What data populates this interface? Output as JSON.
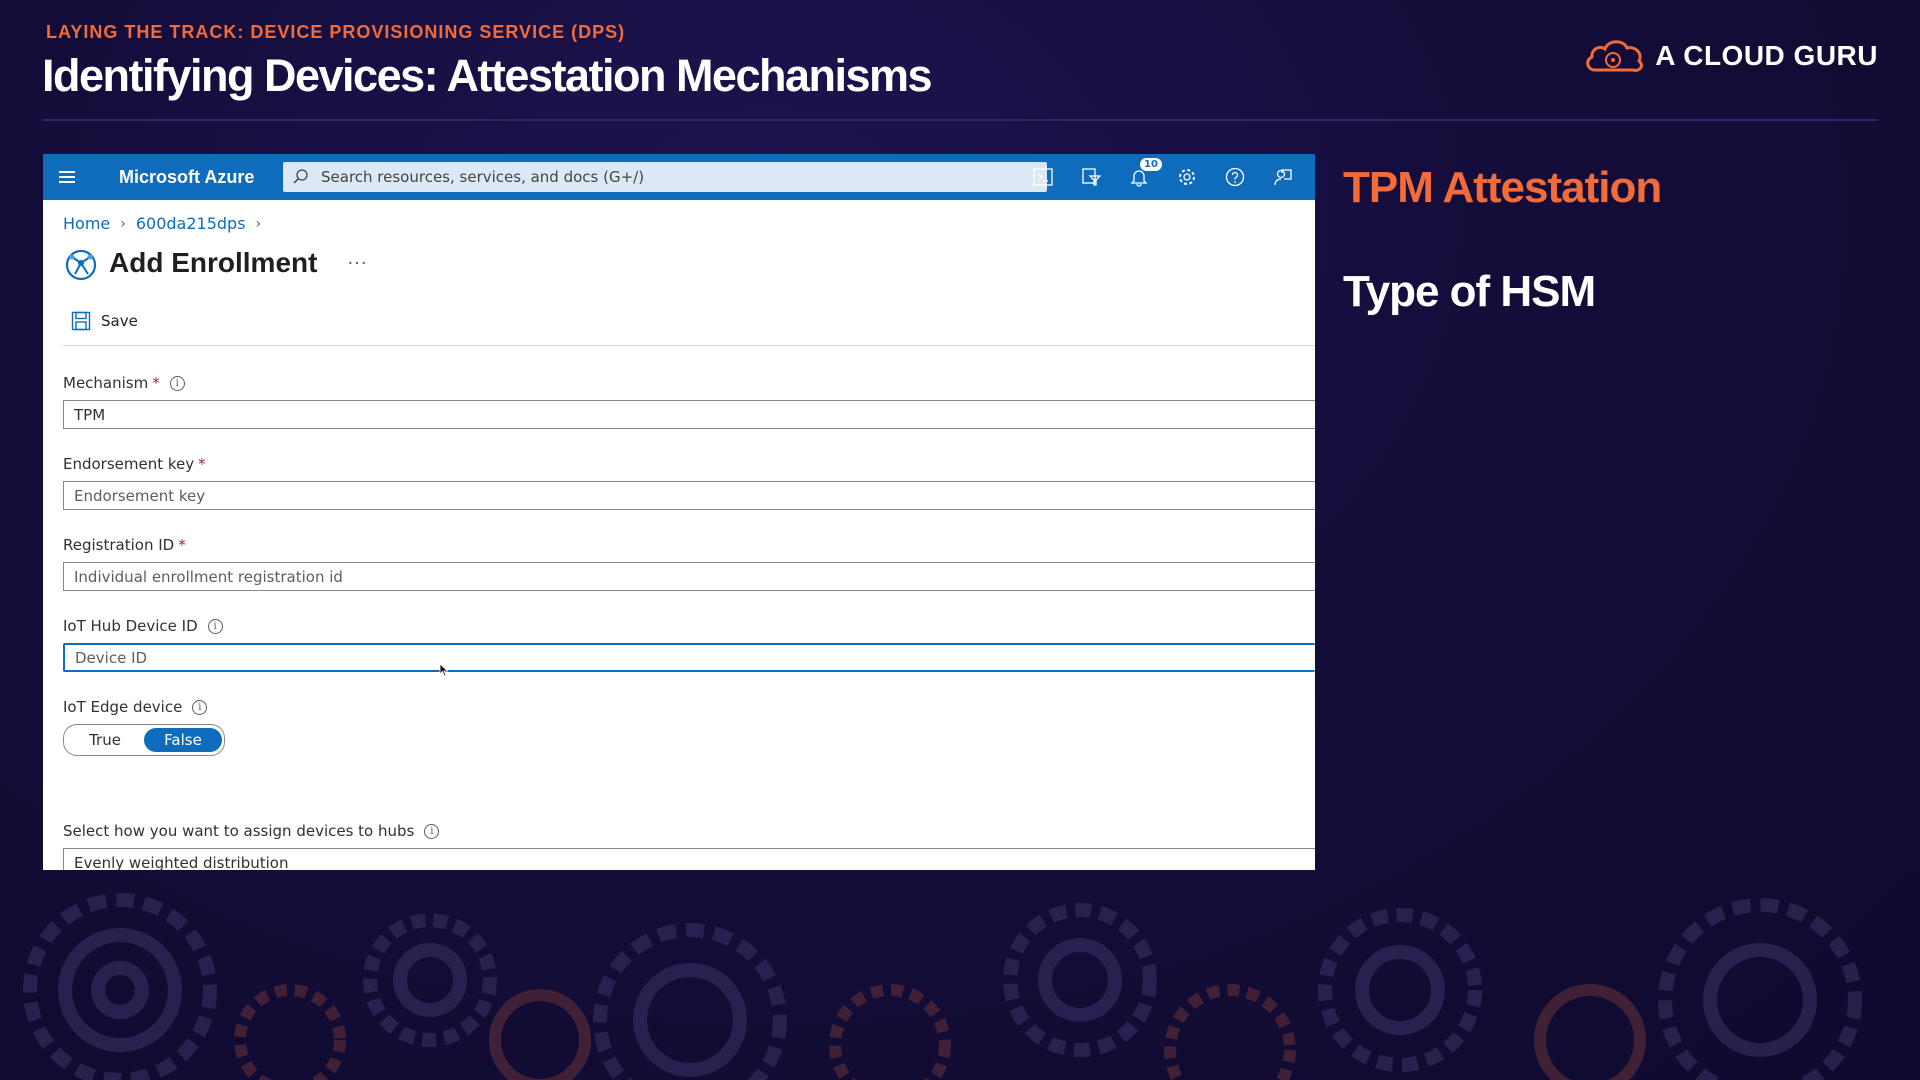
{
  "slide": {
    "kicker": "LAYING THE TRACK: DEVICE PROVISIONING SERVICE (DPS)",
    "title": "Identifying Devices: Attestation Mechanisms",
    "brand": "A CLOUD GURU",
    "side_heading_1": "TPM Attestation",
    "side_heading_2": "Type of HSM",
    "colors": {
      "accent": "#f26b3a",
      "background": "#140d3a",
      "azure_blue": "#0f6cbd"
    }
  },
  "portal": {
    "name": "Microsoft Azure",
    "search_placeholder": "Search resources, services, and docs (G+/)",
    "notification_count": "10",
    "top_icons": [
      "cloud-shell-icon",
      "directory-filter-icon",
      "notifications-icon",
      "settings-icon",
      "help-icon",
      "feedback-icon"
    ],
    "breadcrumb": [
      "Home",
      "600da215dps"
    ],
    "page_title": "Add Enrollment",
    "more": "···",
    "save_label": "Save",
    "form": {
      "mechanism": {
        "label": "Mechanism",
        "required": "*",
        "value": "TPM"
      },
      "endorsement_key": {
        "label": "Endorsement key",
        "required": "*",
        "placeholder": "Endorsement key"
      },
      "registration_id": {
        "label": "Registration ID",
        "required": "*",
        "placeholder": "Individual enrollment registration id"
      },
      "iot_hub_device_id": {
        "label": "IoT Hub Device ID",
        "placeholder": "Device ID"
      },
      "iot_edge_device": {
        "label": "IoT Edge device",
        "options": [
          "True",
          "False"
        ],
        "selected": "False"
      },
      "assign_hubs": {
        "label": "Select how you want to assign devices to hubs",
        "value": "Evenly weighted distribution"
      }
    }
  }
}
